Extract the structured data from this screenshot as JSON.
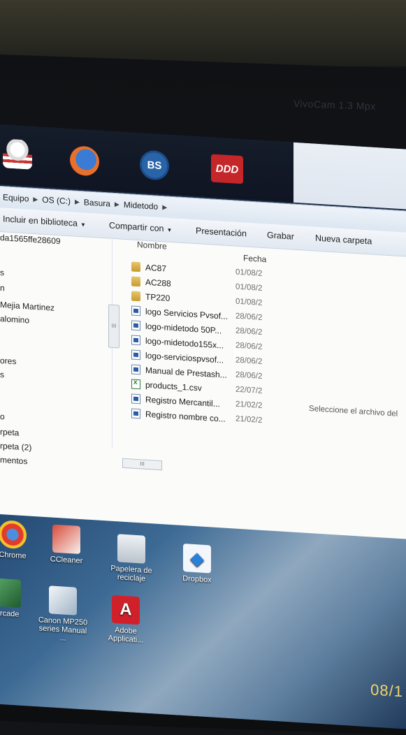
{
  "camera": {
    "label": "VivoCam 1.3 Mpx"
  },
  "taskbar": {
    "icons": [
      {
        "name": "popcorn-icon"
      },
      {
        "name": "firefox-icon"
      },
      {
        "name": "bluestacks-icon",
        "text": "BS"
      },
      {
        "name": "ddd-icon",
        "text": "DDD"
      }
    ]
  },
  "address": {
    "crumbs": [
      "Equipo",
      "OS (C:)",
      "Basura",
      "Midetodo"
    ]
  },
  "commands": {
    "library": "Incluir en biblioteca",
    "share": "Compartir con",
    "presentation": "Presentación",
    "burn": "Grabar",
    "new_folder": "Nueva carpeta"
  },
  "nav": {
    "items": [
      "da1565ffe28609",
      "s",
      "n",
      "Mejia Martinez",
      "alomino",
      "ores",
      "s",
      "o",
      "rpeta",
      "rpeta (2)",
      "mentos"
    ]
  },
  "columns": {
    "name": "Nombre",
    "date": "Fecha"
  },
  "files": [
    {
      "name": "AC87",
      "date": "01/08/2",
      "type": "folder"
    },
    {
      "name": "AC288",
      "date": "01/08/2",
      "type": "folder"
    },
    {
      "name": "TP220",
      "date": "01/08/2",
      "type": "folder"
    },
    {
      "name": "logo Servicios Pvsof...",
      "date": "28/06/2",
      "type": "image"
    },
    {
      "name": "logo-midetodo 50P...",
      "date": "28/06/2",
      "type": "image"
    },
    {
      "name": "logo-midetodo155x...",
      "date": "28/06/2",
      "type": "image"
    },
    {
      "name": "logo-serviciospvsof...",
      "date": "28/06/2",
      "type": "image"
    },
    {
      "name": "Manual de Prestash...",
      "date": "28/06/2",
      "type": "document"
    },
    {
      "name": "products_1.csv",
      "date": "22/07/2",
      "type": "spreadsheet"
    },
    {
      "name": "Registro Mercantil...",
      "date": "21/02/2",
      "type": "document"
    },
    {
      "name": "Registro nombre co...",
      "date": "21/02/2",
      "type": "document"
    }
  ],
  "preview": {
    "message": "Seleccione el archivo del"
  },
  "scroll": {
    "grip": "III"
  },
  "desktop": {
    "icons": [
      {
        "label": "Chrome",
        "color": "#d23b2b"
      },
      {
        "label": "CCleaner",
        "color": "#c83a2f"
      },
      {
        "label": "Papelera de reciclaje",
        "color": "#cfd7df"
      },
      {
        "label": "Dropbox",
        "color": "#2a7fd8"
      },
      {
        "label": "Arcade",
        "color": "#3a8a4a"
      },
      {
        "label": "Canon MP250 series Manual ...",
        "color": "#dfe7ee"
      },
      {
        "label": "Adobe Applicati...",
        "color": "#d0212a"
      }
    ],
    "clock": "08/1"
  }
}
